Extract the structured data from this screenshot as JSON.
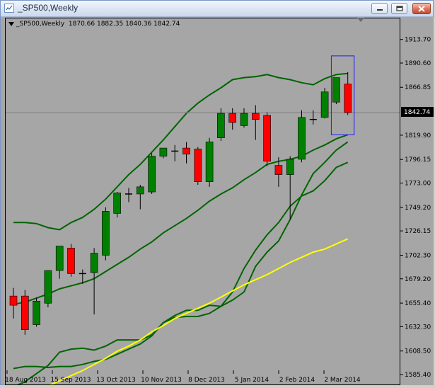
{
  "window": {
    "title": "_SP500,Weekly",
    "controls": [
      "minimize",
      "restore",
      "close"
    ]
  },
  "legend": {
    "symbol": "_SP500,Weekly",
    "ohlc": "1870.66 1882.35 1840.36 1842.74"
  },
  "chart_data": {
    "type": "candlestick",
    "title": "_SP500,Weekly",
    "ylim": [
      1575,
      1935
    ],
    "y_ticks": [
      "1913.70",
      "1890.60",
      "1866.85",
      "1842.74",
      "1819.90",
      "1796.15",
      "1773.00",
      "1749.20",
      "1726.15",
      "1702.30",
      "1679.20",
      "1655.40",
      "1632.30",
      "1608.50",
      "1585.40"
    ],
    "x_ticks": [
      "18 Aug 2013",
      "15 Sep 2013",
      "13 Oct 2013",
      "10 Nov 2013",
      "8 Dec 2013",
      "5 Jan 2014",
      "2 Feb 2014",
      "2 Mar 2014"
    ],
    "current_price_label": "1842.74",
    "grid": false,
    "colors": {
      "background": "#a6a6a6",
      "bull": "#008000",
      "bear": "#ff0000",
      "doji": "#000000",
      "band": "#006400",
      "ma_yellow": "#ffff00",
      "price_line": "#808080",
      "selection_box": "#1a1aff",
      "price_label_bg": "#000000",
      "price_label_text": "#ffffff"
    },
    "candles": [
      {
        "o": 1663,
        "h": 1671,
        "l": 1641,
        "c": 1654
      },
      {
        "o": 1663,
        "h": 1669,
        "l": 1625,
        "c": 1630
      },
      {
        "o": 1635,
        "h": 1661,
        "l": 1633,
        "c": 1658
      },
      {
        "o": 1656,
        "h": 1688,
        "l": 1652,
        "c": 1688
      },
      {
        "o": 1688,
        "h": 1710,
        "l": 1680,
        "c": 1712
      },
      {
        "o": 1710,
        "h": 1714,
        "l": 1682,
        "c": 1685
      },
      {
        "o": 1685,
        "h": 1689,
        "l": 1675,
        "c": 1685
      },
      {
        "o": 1686,
        "h": 1710,
        "l": 1645,
        "c": 1705
      },
      {
        "o": 1703,
        "h": 1750,
        "l": 1698,
        "c": 1746
      },
      {
        "o": 1744,
        "h": 1765,
        "l": 1740,
        "c": 1764
      },
      {
        "o": 1763,
        "h": 1769,
        "l": 1755,
        "c": 1763
      },
      {
        "o": 1763,
        "h": 1772,
        "l": 1748,
        "c": 1770
      },
      {
        "o": 1765,
        "h": 1803,
        "l": 1763,
        "c": 1800
      },
      {
        "o": 1800,
        "h": 1808,
        "l": 1798,
        "c": 1808
      },
      {
        "o": 1805,
        "h": 1811,
        "l": 1795,
        "c": 1805
      },
      {
        "o": 1808,
        "h": 1814,
        "l": 1793,
        "c": 1802
      },
      {
        "o": 1807,
        "h": 1809,
        "l": 1772,
        "c": 1775
      },
      {
        "o": 1775,
        "h": 1818,
        "l": 1770,
        "c": 1814
      },
      {
        "o": 1818,
        "h": 1847,
        "l": 1815,
        "c": 1842
      },
      {
        "o": 1842,
        "h": 1847,
        "l": 1826,
        "c": 1833
      },
      {
        "o": 1830,
        "h": 1847,
        "l": 1828,
        "c": 1842
      },
      {
        "o": 1842,
        "h": 1850,
        "l": 1816,
        "c": 1836
      },
      {
        "o": 1840,
        "h": 1843,
        "l": 1790,
        "c": 1795
      },
      {
        "o": 1791,
        "h": 1799,
        "l": 1770,
        "c": 1782
      },
      {
        "o": 1782,
        "h": 1800,
        "l": 1738,
        "c": 1797
      },
      {
        "o": 1797,
        "h": 1845,
        "l": 1794,
        "c": 1838
      },
      {
        "o": 1836,
        "h": 1845,
        "l": 1831,
        "c": 1835
      },
      {
        "o": 1838,
        "h": 1867,
        "l": 1837,
        "c": 1863
      },
      {
        "o": 1853,
        "h": 1877,
        "l": 1851,
        "c": 1877
      },
      {
        "o": 1870.66,
        "h": 1882.35,
        "l": 1840.36,
        "c": 1842.74
      }
    ],
    "series": [
      {
        "values": [
          1735,
          1735,
          1734,
          1730,
          1728,
          1735,
          1740,
          1748,
          1758,
          1770,
          1782,
          1792,
          1804,
          1816,
          1829,
          1842,
          1852,
          1860,
          1867,
          1875,
          1877,
          1878,
          1880,
          1877,
          1875,
          1872,
          1870,
          1876,
          1880,
          1881
        ]
      },
      {
        "values": [
          1655,
          1657,
          1661,
          1665,
          1670,
          1673,
          1676,
          1680,
          1687,
          1694,
          1701,
          1709,
          1716,
          1725,
          1732,
          1739,
          1747,
          1756,
          1763,
          1769,
          1777,
          1784,
          1792,
          1795,
          1797,
          1800,
          1806,
          1811,
          1817,
          1821
        ]
      },
      {
        "values": [
          1574,
          1579,
          1587,
          1595,
          1608,
          1611,
          1612,
          1610,
          1614,
          1620,
          1620,
          1620,
          1625,
          1637,
          1642,
          1643,
          1643,
          1646,
          1653,
          1659,
          1667,
          1692,
          1706,
          1717,
          1738,
          1762,
          1783,
          1794,
          1806,
          1814
        ]
      },
      {
        "values": [
          1592,
          1594,
          1594,
          1593,
          1594,
          1594,
          1596,
          1599,
          1601,
          1606,
          1611,
          1616,
          1624,
          1637,
          1644,
          1649,
          1649,
          1654,
          1653,
          1667,
          1690,
          1708,
          1723,
          1735,
          1751,
          1761,
          1766,
          1776,
          1789,
          1794
        ]
      },
      {
        "values": [
          1563,
          1567,
          1571,
          1575,
          1580,
          1585,
          1590,
          1596,
          1602,
          1609,
          1614,
          1620,
          1628,
          1634,
          1641,
          1646,
          1651,
          1656,
          1662,
          1668,
          1674,
          1679,
          1684,
          1690,
          1696,
          1701,
          1706,
          1709,
          1714,
          1719
        ]
      }
    ],
    "selection_box_candles": [
      28,
      29
    ]
  }
}
